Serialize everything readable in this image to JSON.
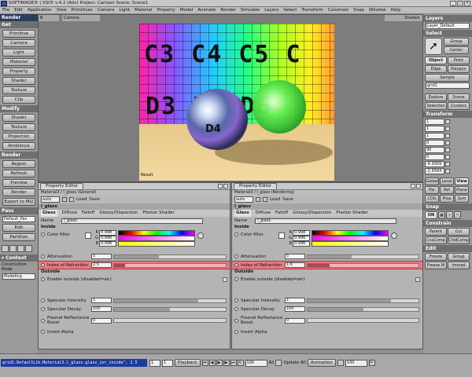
{
  "window": {
    "title": "SOFTIMAGE® | XSI® v.4.2 (Adv) Project: Cartoon   Scene: Scene1"
  },
  "menubar": [
    "File",
    "Edit",
    "Application",
    "View",
    "Primitives",
    "Camera",
    "Light",
    "Material",
    "Property",
    "Model",
    "Animate",
    "Render",
    "Simulate",
    "Layers",
    "Select",
    "Transform",
    "Constrain",
    "Snap",
    "Window",
    "Help"
  ],
  "left_panel": {
    "render_header": "Render",
    "get_header": "Get",
    "get_items": [
      "Primitive",
      "Camera",
      "Light",
      "Material",
      "Property",
      "Shader",
      "Texture",
      "Clip"
    ],
    "modify_header": "Modify",
    "modify_items": [
      "Shader",
      "Texture",
      "Projection",
      "Ambience"
    ],
    "render_section": "Render",
    "render_items": [
      "Region",
      "Refresh",
      "Preview",
      "Render",
      "Export to MI2"
    ],
    "pass_header": "Pass",
    "pass_field": "Default_Pas",
    "pass_items": [
      "Edit",
      "Partition"
    ],
    "context_header": "▾ Context",
    "construction_label": "Construction Mode",
    "construction_value": "Modeling"
  },
  "viewport": {
    "left_label": "B",
    "camera_label": "Camera",
    "mode_label": "Shaded",
    "result_label": "Result",
    "tex_row1": "C3 C4 C5 C",
    "tex_row2": "D3    D5 D6",
    "sphere_letters": "D4"
  },
  "right_panel": {
    "layers_header": "Layers",
    "layer_field": "Layer_Default",
    "select_header": "Select",
    "select_buttons": [
      "Group",
      "Center"
    ],
    "object_button": "Object",
    "point_button": "Point",
    "edge_button": "Edge",
    "polygon_button": "Polygon",
    "sample_button": "Sample",
    "grid_field": "grid1",
    "explore_button": "Explore",
    "scene_button": "Scene",
    "selection_button": "Selection",
    "clusters_button": "Clusters",
    "transform_header": "Transform",
    "transform_values": [
      "1",
      "1",
      "1",
      "0",
      "90",
      "0",
      "-4.9309",
      "-2.6584"
    ],
    "global_label": "Global",
    "local_label": "Local",
    "view_label": "View",
    "par_label": "Par",
    "ref_label": "Ref",
    "plane_label": "Plane",
    "cog_label": "COG",
    "prop_label": "Prop",
    "sym_label": "Sym",
    "snap_header": "Snap",
    "on_label": "ON",
    "constrain_header": "Constrain",
    "constrain_buttons": [
      "Parent",
      "Cut",
      "CnsComp",
      "ChldComp"
    ],
    "edit_header": "Edit",
    "freeze_button": "Freeze",
    "group_button": "Group",
    "freeze_m_button": "Freeze M",
    "immed_button": "Immed"
  },
  "pe_left": {
    "title": "Property Editor",
    "subtitle": "Material3 / l_glass (General)",
    "auto_label": "auto",
    "load_label": "Load",
    "save_label": "Save",
    "group_title": "l_glass",
    "tabs": [
      "Glass",
      "Diffuse",
      "Falloff",
      "Glossy/Dispersion",
      "Photon Shader"
    ],
    "name_label": "Name",
    "name_value": "l_glass",
    "inside_label": "Inside",
    "color_filter_label": "Color filter",
    "r_label": "R",
    "g_label": "G",
    "b_label": "B",
    "rgb_values": [
      "0.998",
      "0.996",
      "0.996"
    ],
    "attenuation_label": "Attenuation",
    "attenuation_value": "5",
    "ior_label": "Index of Refraction",
    "ior_value": "2.5",
    "outside_label": "Outside",
    "enable_outside_label": "Enable outside (disabled=air)",
    "specular_intensity_label": "Specular Intensity",
    "specular_intensity_value": "1",
    "specular_decay_label": "Specular Decay",
    "specular_decay_value": "100",
    "fresnel_label": "Fresnel Reflectance Boost",
    "fresnel_value": "0",
    "invert_alpha_label": "Invert Alpha"
  },
  "pe_right": {
    "title": "Property Editor",
    "subtitle": "Material3 / l_glass (Rendering)",
    "auto_label": "auto",
    "load_label": "Load",
    "save_label": "Save",
    "group_title": "l_glass",
    "tabs": [
      "Glass",
      "Diffuse",
      "Falloff",
      "Glossy/Dispersion",
      "Photon Shader"
    ],
    "name_label": "Name",
    "name_value": "l_glass",
    "inside_label": "Inside",
    "color_filter_label": "Color filter",
    "r_label": "R",
    "g_label": "G",
    "b_label": "B",
    "rgb_values": [
      "0.998",
      "0.996",
      "0.996"
    ],
    "attenuation_label": "Attenuation",
    "attenuation_value": "5",
    "ior_label": "Index of Refraction",
    "ior_value": "1.6",
    "outside_label": "Outside",
    "enable_outside_label": "Enable outside (disabled=air)",
    "specular_intensity_label": "Specular Intensity",
    "specular_intensity_value": "1",
    "specular_decay_label": "Specular Decay",
    "specular_decay_value": "100",
    "fresnel_label": "Fresnel Reflectance Boost",
    "fresnel_value": "0",
    "invert_alpha_label": "Invert Alpha"
  },
  "bottom": {
    "command_line": "grid1.DefaultLib.Material3.l_glass.glass_ior_inside\", 2.5",
    "frame_start": "1",
    "frame_field": "1",
    "playback_label": "Playback",
    "frame_end": "100",
    "all_label": "All",
    "update_label": "Update All",
    "animation_label": "Animation",
    "frame_current": "100"
  },
  "colors": {
    "highlight": "#e47b82",
    "command_line_bg": "#1d3a9d",
    "panel_bg": "#9a9a9a"
  }
}
